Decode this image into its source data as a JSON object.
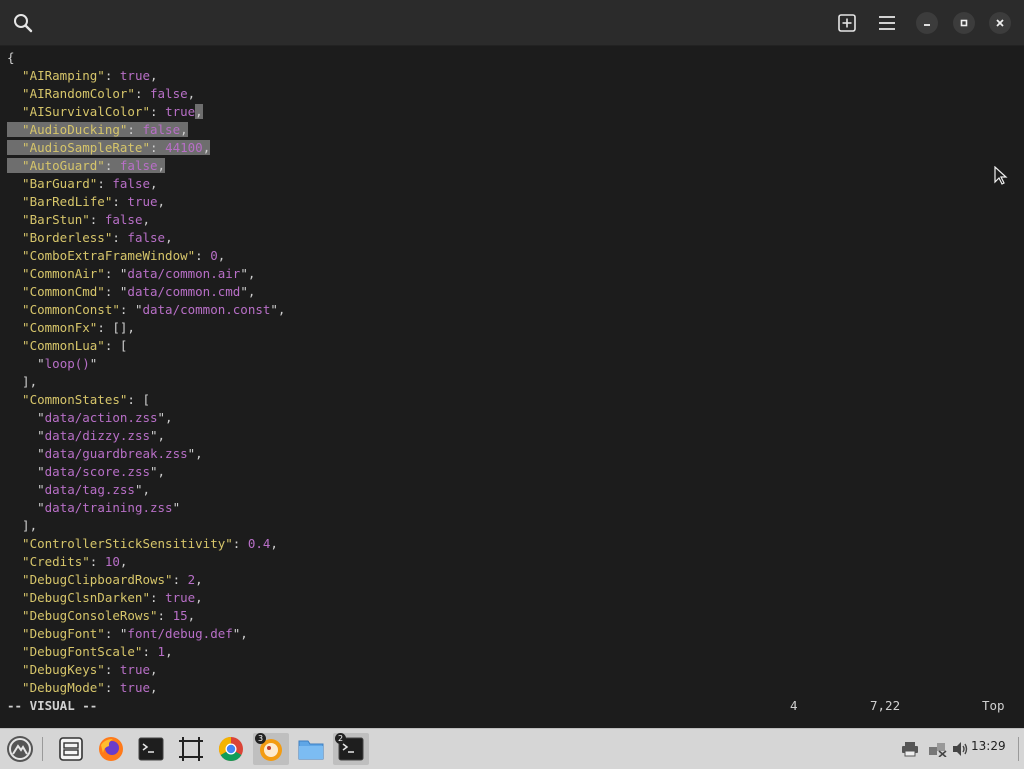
{
  "header": {
    "search_icon": "search-icon",
    "new_tab_icon": "plus-square-icon",
    "menu_icon": "hamburger-icon",
    "window_controls": [
      "minimize-icon",
      "maximize-icon",
      "close-icon"
    ]
  },
  "editor": {
    "lines": [
      [
        {
          "t": "{",
          "c": "p"
        }
      ],
      [
        {
          "t": "  \"AIRamping\"",
          "c": "k"
        },
        {
          "t": ": ",
          "c": "p"
        },
        {
          "t": "true",
          "c": "b"
        },
        {
          "t": ",",
          "c": "p"
        }
      ],
      [
        {
          "t": "  \"AIRandomColor\"",
          "c": "k"
        },
        {
          "t": ": ",
          "c": "p"
        },
        {
          "t": "false",
          "c": "b"
        },
        {
          "t": ",",
          "c": "p"
        }
      ],
      [
        {
          "t": "  \"AISurvivalColor\"",
          "c": "k"
        },
        {
          "t": ": ",
          "c": "p"
        },
        {
          "t": "true",
          "c": "b"
        },
        {
          "t": ",",
          "c": "p",
          "sel": true
        }
      ],
      [
        {
          "t": "  \"AudioDucking\"",
          "c": "k",
          "sel": true
        },
        {
          "t": ": ",
          "c": "p",
          "sel": true
        },
        {
          "t": "false",
          "c": "b",
          "sel": true
        },
        {
          "t": ",",
          "c": "p",
          "sel": true
        }
      ],
      [
        {
          "t": "  \"AudioSampleRate\"",
          "c": "k",
          "sel": true
        },
        {
          "t": ": ",
          "c": "p",
          "sel": true
        },
        {
          "t": "44100",
          "c": "n",
          "sel": true
        },
        {
          "t": ",",
          "c": "p",
          "sel": true
        }
      ],
      [
        {
          "t": "  \"AutoGuard\"",
          "c": "k",
          "sel": true
        },
        {
          "t": ": ",
          "c": "p",
          "sel": true
        },
        {
          "t": "false",
          "c": "b",
          "sel": true
        },
        {
          "t": ",",
          "c": "p",
          "sel": true
        }
      ],
      [
        {
          "t": "  \"BarGuard\"",
          "c": "k"
        },
        {
          "t": ": ",
          "c": "p"
        },
        {
          "t": "false",
          "c": "b"
        },
        {
          "t": ",",
          "c": "p"
        }
      ],
      [
        {
          "t": "  \"BarRedLife\"",
          "c": "k"
        },
        {
          "t": ": ",
          "c": "p"
        },
        {
          "t": "true",
          "c": "b"
        },
        {
          "t": ",",
          "c": "p"
        }
      ],
      [
        {
          "t": "  \"BarStun\"",
          "c": "k"
        },
        {
          "t": ": ",
          "c": "p"
        },
        {
          "t": "false",
          "c": "b"
        },
        {
          "t": ",",
          "c": "p"
        }
      ],
      [
        {
          "t": "  \"Borderless\"",
          "c": "k"
        },
        {
          "t": ": ",
          "c": "p"
        },
        {
          "t": "false",
          "c": "b"
        },
        {
          "t": ",",
          "c": "p"
        }
      ],
      [
        {
          "t": "  \"ComboExtraFrameWindow\"",
          "c": "k"
        },
        {
          "t": ": ",
          "c": "p"
        },
        {
          "t": "0",
          "c": "n"
        },
        {
          "t": ",",
          "c": "p"
        }
      ],
      [
        {
          "t": "  \"CommonAir\"",
          "c": "k"
        },
        {
          "t": ": \"",
          "c": "p"
        },
        {
          "t": "data/common.air",
          "c": "s"
        },
        {
          "t": "\",",
          "c": "p"
        }
      ],
      [
        {
          "t": "  \"CommonCmd\"",
          "c": "k"
        },
        {
          "t": ": \"",
          "c": "p"
        },
        {
          "t": "data/common.cmd",
          "c": "s"
        },
        {
          "t": "\",",
          "c": "p"
        }
      ],
      [
        {
          "t": "  \"CommonConst\"",
          "c": "k"
        },
        {
          "t": ": \"",
          "c": "p"
        },
        {
          "t": "data/common.const",
          "c": "s"
        },
        {
          "t": "\",",
          "c": "p"
        }
      ],
      [
        {
          "t": "  \"CommonFx\"",
          "c": "k"
        },
        {
          "t": ": [],",
          "c": "p"
        }
      ],
      [
        {
          "t": "  \"CommonLua\"",
          "c": "k"
        },
        {
          "t": ": [",
          "c": "p"
        }
      ],
      [
        {
          "t": "    \"",
          "c": "p"
        },
        {
          "t": "loop()",
          "c": "s"
        },
        {
          "t": "\"",
          "c": "p"
        }
      ],
      [
        {
          "t": "  ],",
          "c": "p"
        }
      ],
      [
        {
          "t": "  \"CommonStates\"",
          "c": "k"
        },
        {
          "t": ": [",
          "c": "p"
        }
      ],
      [
        {
          "t": "    \"",
          "c": "p"
        },
        {
          "t": "data/action.zss",
          "c": "s"
        },
        {
          "t": "\",",
          "c": "p"
        }
      ],
      [
        {
          "t": "    \"",
          "c": "p"
        },
        {
          "t": "data/dizzy.zss",
          "c": "s"
        },
        {
          "t": "\",",
          "c": "p"
        }
      ],
      [
        {
          "t": "    \"",
          "c": "p"
        },
        {
          "t": "data/guardbreak.zss",
          "c": "s"
        },
        {
          "t": "\",",
          "c": "p"
        }
      ],
      [
        {
          "t": "    \"",
          "c": "p"
        },
        {
          "t": "data/score.zss",
          "c": "s"
        },
        {
          "t": "\",",
          "c": "p"
        }
      ],
      [
        {
          "t": "    \"",
          "c": "p"
        },
        {
          "t": "data/tag.zss",
          "c": "s"
        },
        {
          "t": "\",",
          "c": "p"
        }
      ],
      [
        {
          "t": "    \"",
          "c": "p"
        },
        {
          "t": "data/training.zss",
          "c": "s"
        },
        {
          "t": "\"",
          "c": "p"
        }
      ],
      [
        {
          "t": "  ],",
          "c": "p"
        }
      ],
      [
        {
          "t": "  \"ControllerStickSensitivity\"",
          "c": "k"
        },
        {
          "t": ": ",
          "c": "p"
        },
        {
          "t": "0.4",
          "c": "n"
        },
        {
          "t": ",",
          "c": "p"
        }
      ],
      [
        {
          "t": "  \"Credits\"",
          "c": "k"
        },
        {
          "t": ": ",
          "c": "p"
        },
        {
          "t": "10",
          "c": "n"
        },
        {
          "t": ",",
          "c": "p"
        }
      ],
      [
        {
          "t": "  \"DebugClipboardRows\"",
          "c": "k"
        },
        {
          "t": ": ",
          "c": "p"
        },
        {
          "t": "2",
          "c": "n"
        },
        {
          "t": ",",
          "c": "p"
        }
      ],
      [
        {
          "t": "  \"DebugClsnDarken\"",
          "c": "k"
        },
        {
          "t": ": ",
          "c": "p"
        },
        {
          "t": "true",
          "c": "b"
        },
        {
          "t": ",",
          "c": "p"
        }
      ],
      [
        {
          "t": "  \"DebugConsoleRows\"",
          "c": "k"
        },
        {
          "t": ": ",
          "c": "p"
        },
        {
          "t": "15",
          "c": "n"
        },
        {
          "t": ",",
          "c": "p"
        }
      ],
      [
        {
          "t": "  \"DebugFont\"",
          "c": "k"
        },
        {
          "t": ": \"",
          "c": "p"
        },
        {
          "t": "font/debug.def",
          "c": "s"
        },
        {
          "t": "\",",
          "c": "p"
        }
      ],
      [
        {
          "t": "  \"DebugFontScale\"",
          "c": "k"
        },
        {
          "t": ": ",
          "c": "p"
        },
        {
          "t": "1",
          "c": "n"
        },
        {
          "t": ",",
          "c": "p"
        }
      ],
      [
        {
          "t": "  \"DebugKeys\"",
          "c": "k"
        },
        {
          "t": ": ",
          "c": "p"
        },
        {
          "t": "true",
          "c": "b"
        },
        {
          "t": ",",
          "c": "p"
        }
      ],
      [
        {
          "t": "  \"DebugMode\"",
          "c": "k"
        },
        {
          "t": ": ",
          "c": "p"
        },
        {
          "t": "true",
          "c": "b"
        },
        {
          "t": ",",
          "c": "p"
        }
      ]
    ]
  },
  "status": {
    "mode": "-- VISUAL --",
    "selection_count": "4",
    "position": "7,22",
    "scroll": "Top"
  },
  "taskbar": {
    "apps": [
      {
        "name": "launcher-icon"
      },
      {
        "name": "file-manager-icon"
      },
      {
        "name": "firefox-icon"
      },
      {
        "name": "terminal-icon"
      },
      {
        "name": "screenshot-tool-icon"
      },
      {
        "name": "chrome-icon"
      },
      {
        "name": "app-orange-icon",
        "badge": "3"
      },
      {
        "name": "files-folder-icon"
      },
      {
        "name": "terminal-active-icon",
        "badge": "2"
      }
    ],
    "tray": [
      "printer-icon",
      "network-icon",
      "volume-icon"
    ],
    "clock": "13:29"
  },
  "colors": {
    "key": "#d6c56a",
    "value": "#b86fc7",
    "selection": "#6e6e6e",
    "background": "#1c1c1c"
  }
}
